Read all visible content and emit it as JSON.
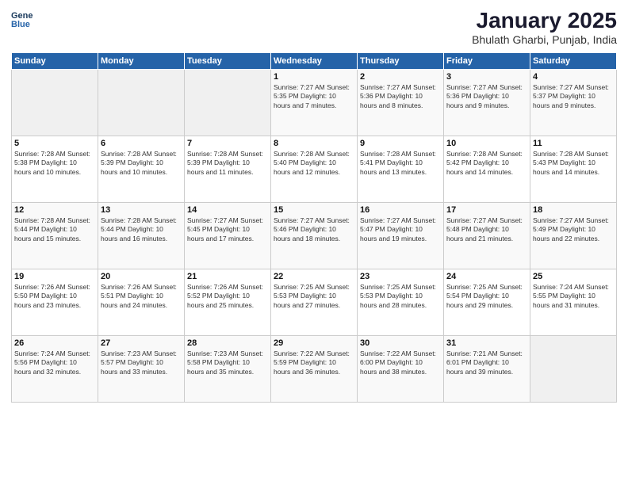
{
  "header": {
    "logo_line1": "General",
    "logo_line2": "Blue",
    "title": "January 2025",
    "subtitle": "Bhulath Gharbi, Punjab, India"
  },
  "weekdays": [
    "Sunday",
    "Monday",
    "Tuesday",
    "Wednesday",
    "Thursday",
    "Friday",
    "Saturday"
  ],
  "weeks": [
    [
      {
        "day": "",
        "info": ""
      },
      {
        "day": "",
        "info": ""
      },
      {
        "day": "",
        "info": ""
      },
      {
        "day": "1",
        "info": "Sunrise: 7:27 AM\nSunset: 5:35 PM\nDaylight: 10 hours\nand 7 minutes."
      },
      {
        "day": "2",
        "info": "Sunrise: 7:27 AM\nSunset: 5:36 PM\nDaylight: 10 hours\nand 8 minutes."
      },
      {
        "day": "3",
        "info": "Sunrise: 7:27 AM\nSunset: 5:36 PM\nDaylight: 10 hours\nand 9 minutes."
      },
      {
        "day": "4",
        "info": "Sunrise: 7:27 AM\nSunset: 5:37 PM\nDaylight: 10 hours\nand 9 minutes."
      }
    ],
    [
      {
        "day": "5",
        "info": "Sunrise: 7:28 AM\nSunset: 5:38 PM\nDaylight: 10 hours\nand 10 minutes."
      },
      {
        "day": "6",
        "info": "Sunrise: 7:28 AM\nSunset: 5:39 PM\nDaylight: 10 hours\nand 10 minutes."
      },
      {
        "day": "7",
        "info": "Sunrise: 7:28 AM\nSunset: 5:39 PM\nDaylight: 10 hours\nand 11 minutes."
      },
      {
        "day": "8",
        "info": "Sunrise: 7:28 AM\nSunset: 5:40 PM\nDaylight: 10 hours\nand 12 minutes."
      },
      {
        "day": "9",
        "info": "Sunrise: 7:28 AM\nSunset: 5:41 PM\nDaylight: 10 hours\nand 13 minutes."
      },
      {
        "day": "10",
        "info": "Sunrise: 7:28 AM\nSunset: 5:42 PM\nDaylight: 10 hours\nand 14 minutes."
      },
      {
        "day": "11",
        "info": "Sunrise: 7:28 AM\nSunset: 5:43 PM\nDaylight: 10 hours\nand 14 minutes."
      }
    ],
    [
      {
        "day": "12",
        "info": "Sunrise: 7:28 AM\nSunset: 5:44 PM\nDaylight: 10 hours\nand 15 minutes."
      },
      {
        "day": "13",
        "info": "Sunrise: 7:28 AM\nSunset: 5:44 PM\nDaylight: 10 hours\nand 16 minutes."
      },
      {
        "day": "14",
        "info": "Sunrise: 7:27 AM\nSunset: 5:45 PM\nDaylight: 10 hours\nand 17 minutes."
      },
      {
        "day": "15",
        "info": "Sunrise: 7:27 AM\nSunset: 5:46 PM\nDaylight: 10 hours\nand 18 minutes."
      },
      {
        "day": "16",
        "info": "Sunrise: 7:27 AM\nSunset: 5:47 PM\nDaylight: 10 hours\nand 19 minutes."
      },
      {
        "day": "17",
        "info": "Sunrise: 7:27 AM\nSunset: 5:48 PM\nDaylight: 10 hours\nand 21 minutes."
      },
      {
        "day": "18",
        "info": "Sunrise: 7:27 AM\nSunset: 5:49 PM\nDaylight: 10 hours\nand 22 minutes."
      }
    ],
    [
      {
        "day": "19",
        "info": "Sunrise: 7:26 AM\nSunset: 5:50 PM\nDaylight: 10 hours\nand 23 minutes."
      },
      {
        "day": "20",
        "info": "Sunrise: 7:26 AM\nSunset: 5:51 PM\nDaylight: 10 hours\nand 24 minutes."
      },
      {
        "day": "21",
        "info": "Sunrise: 7:26 AM\nSunset: 5:52 PM\nDaylight: 10 hours\nand 25 minutes."
      },
      {
        "day": "22",
        "info": "Sunrise: 7:25 AM\nSunset: 5:53 PM\nDaylight: 10 hours\nand 27 minutes."
      },
      {
        "day": "23",
        "info": "Sunrise: 7:25 AM\nSunset: 5:53 PM\nDaylight: 10 hours\nand 28 minutes."
      },
      {
        "day": "24",
        "info": "Sunrise: 7:25 AM\nSunset: 5:54 PM\nDaylight: 10 hours\nand 29 minutes."
      },
      {
        "day": "25",
        "info": "Sunrise: 7:24 AM\nSunset: 5:55 PM\nDaylight: 10 hours\nand 31 minutes."
      }
    ],
    [
      {
        "day": "26",
        "info": "Sunrise: 7:24 AM\nSunset: 5:56 PM\nDaylight: 10 hours\nand 32 minutes."
      },
      {
        "day": "27",
        "info": "Sunrise: 7:23 AM\nSunset: 5:57 PM\nDaylight: 10 hours\nand 33 minutes."
      },
      {
        "day": "28",
        "info": "Sunrise: 7:23 AM\nSunset: 5:58 PM\nDaylight: 10 hours\nand 35 minutes."
      },
      {
        "day": "29",
        "info": "Sunrise: 7:22 AM\nSunset: 5:59 PM\nDaylight: 10 hours\nand 36 minutes."
      },
      {
        "day": "30",
        "info": "Sunrise: 7:22 AM\nSunset: 6:00 PM\nDaylight: 10 hours\nand 38 minutes."
      },
      {
        "day": "31",
        "info": "Sunrise: 7:21 AM\nSunset: 6:01 PM\nDaylight: 10 hours\nand 39 minutes."
      },
      {
        "day": "",
        "info": ""
      }
    ]
  ]
}
